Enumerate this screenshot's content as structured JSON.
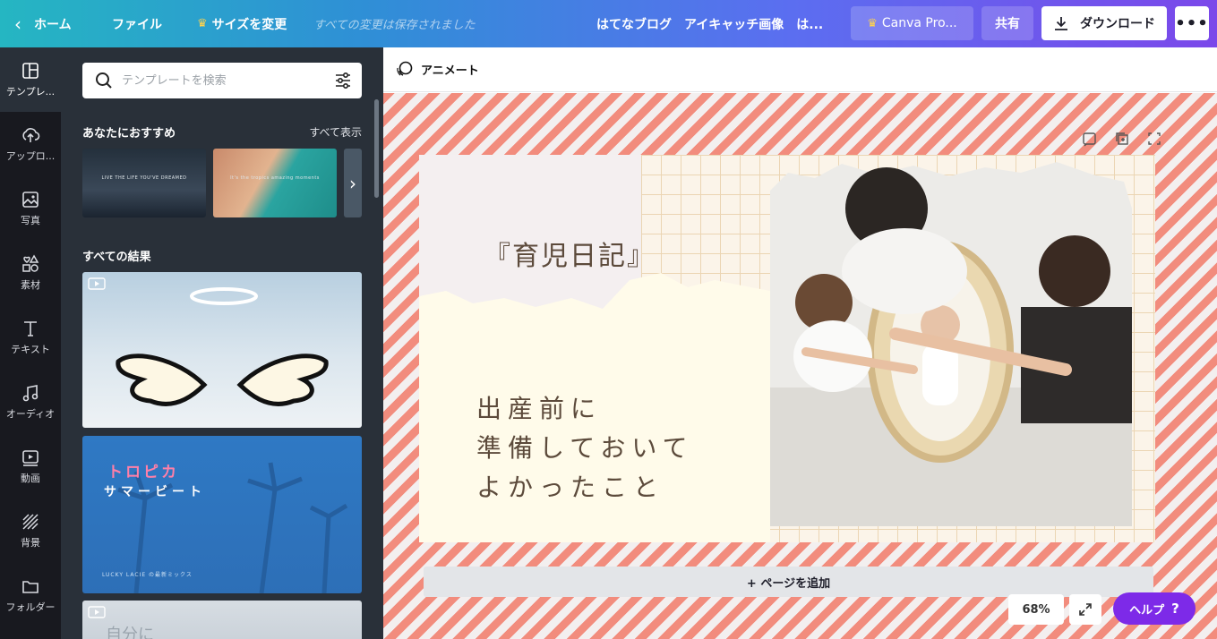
{
  "topbar": {
    "home_label": "ホーム",
    "file_label": "ファイル",
    "resize_label": "サイズを変更",
    "saved_status": "すべての変更は保存されました",
    "doc_title": "はてなブログ　アイキャッチ画像　は...",
    "pro_label": "Canva Pro...",
    "share_label": "共有",
    "download_label": "ダウンロード",
    "more_label": "•••"
  },
  "rail": {
    "items": [
      {
        "label": "テンプレ...",
        "icon": "template-icon"
      },
      {
        "label": "アップロ...",
        "icon": "upload-icon"
      },
      {
        "label": "写真",
        "icon": "photo-icon"
      },
      {
        "label": "素材",
        "icon": "elements-icon"
      },
      {
        "label": "テキスト",
        "icon": "text-icon"
      },
      {
        "label": "オーディオ",
        "icon": "audio-icon"
      },
      {
        "label": "動画",
        "icon": "video-icon"
      },
      {
        "label": "背景",
        "icon": "background-icon"
      },
      {
        "label": "フォルダー",
        "icon": "folder-icon"
      }
    ]
  },
  "panel": {
    "search_placeholder": "テンプレートを検索",
    "recommended_title": "あなたにおすすめ",
    "see_all_label": "すべて表示",
    "thumb1_caption": "LIVE THE LIFE YOU'VE DREAMED",
    "thumb2_caption": "It's the tropics amazing moments",
    "all_results_title": "すべての結果",
    "result2_title_pink": "トロピカ",
    "result2_title_white": "サマービート",
    "result2_caption": "LUCKY LACIE の最新ミックス",
    "result3_text": "自分に"
  },
  "canvas": {
    "animate_label": "アニメート",
    "page_title": "『育児日記』",
    "page_body": [
      "出産前に",
      "準備しておいて",
      "よかったこと"
    ],
    "add_page_label": "+ ページを追加",
    "zoom_label": "68%",
    "help_label": "ヘルプ",
    "help_q": "?"
  },
  "colors": {
    "accent_purple": "#7d2ae8",
    "stripe_coral": "#f28c7d",
    "text_brown": "#5c4a3b"
  }
}
